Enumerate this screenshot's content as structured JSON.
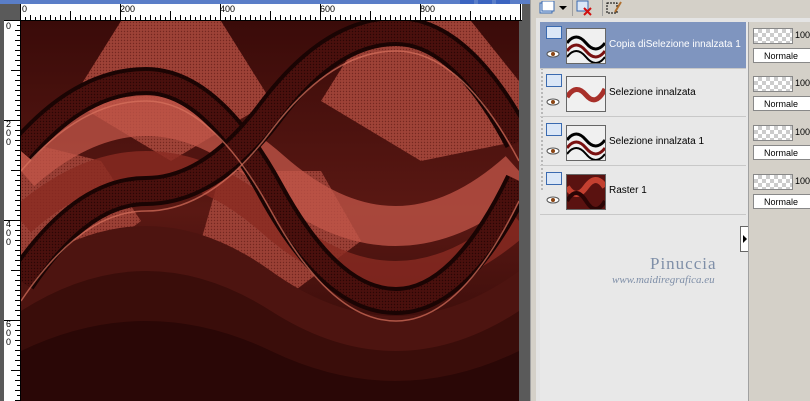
{
  "window": {
    "accent": "#5a7ec8"
  },
  "rulers": {
    "top_labels": [
      "0",
      "200",
      "400",
      "600",
      "800"
    ],
    "left_labels": [
      "0",
      "2\n0\n0",
      "4\n0\n0",
      "6\n0\n0"
    ]
  },
  "canvas": {
    "colors": {
      "dark": "#2a0706",
      "mid": "#6b1d17",
      "light": "#c35749",
      "highlight": "#d9725e"
    }
  },
  "layer_toolbar": {
    "icons": [
      "new-layer-icon",
      "dropdown-arrow-icon",
      "delete-layer-icon",
      "selection-tool-icon"
    ]
  },
  "layers": [
    {
      "name": "Copia diSelezione innalzata 1",
      "opacity": "100",
      "blend": "Normale",
      "selected": true,
      "thumb": "wave-black"
    },
    {
      "name": "Selezione innalzata",
      "opacity": "100",
      "blend": "Normale",
      "selected": false,
      "thumb": "wave-red"
    },
    {
      "name": "Selezione innalzata 1",
      "opacity": "100",
      "blend": "Normale",
      "selected": false,
      "thumb": "wave-black"
    },
    {
      "name": "Raster 1",
      "opacity": "100",
      "blend": "Normale",
      "selected": false,
      "thumb": "raster"
    }
  ],
  "watermark": {
    "name": "Pinuccia",
    "url": "www.maidiregrafica.eu"
  }
}
